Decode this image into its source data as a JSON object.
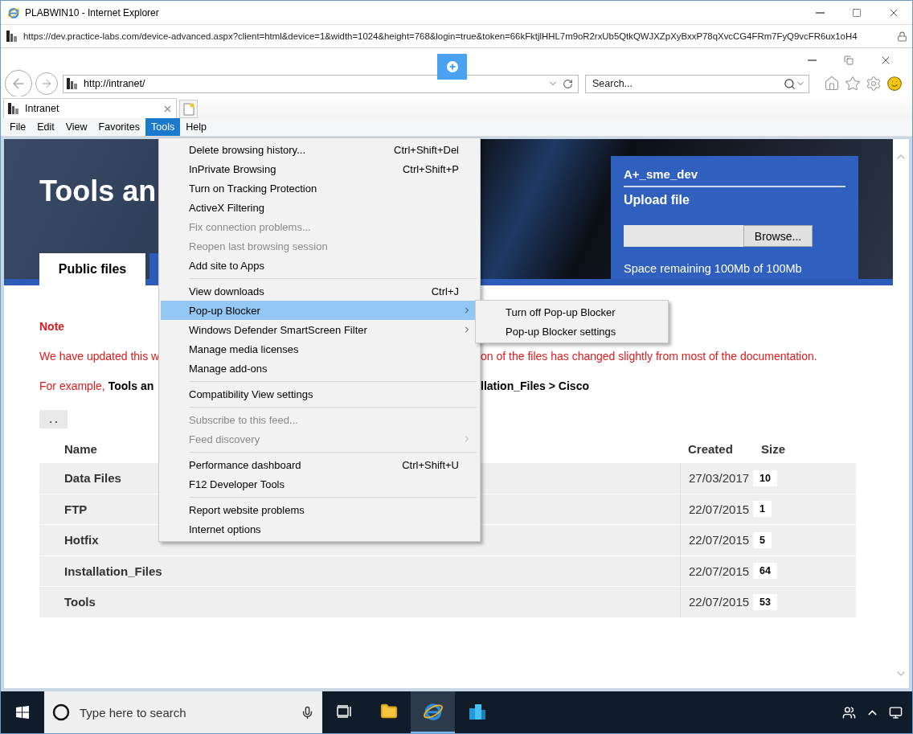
{
  "window": {
    "title": "PLABWIN10 - Internet Explorer"
  },
  "remote_url": "https://dev.practice-labs.com/device-advanced.aspx?client=html&device=1&width=1024&height=768&login=true&token=66kFktjlHHL7m9oR2rxUb5QtkQWJXZpXyBxxP78qXvcCG4FRm7FyQ9vcFR6ux1oH4",
  "browser": {
    "address": "http://intranet/",
    "search_placeholder": "Search...",
    "tab_title": "Intranet"
  },
  "menu_bar": [
    {
      "label": "File",
      "selected": false
    },
    {
      "label": "Edit",
      "selected": false
    },
    {
      "label": "View",
      "selected": false
    },
    {
      "label": "Favorites",
      "selected": false
    },
    {
      "label": "Tools",
      "selected": true
    },
    {
      "label": "Help",
      "selected": false
    }
  ],
  "tools_menu": {
    "groups": [
      [
        {
          "label": "Delete browsing history...",
          "shortcut": "Ctrl+Shift+Del",
          "disabled": false,
          "selected": false,
          "has_submenu": false
        },
        {
          "label": "InPrivate Browsing",
          "shortcut": "Ctrl+Shift+P",
          "disabled": false,
          "selected": false,
          "has_submenu": false
        },
        {
          "label": "Turn on Tracking Protection",
          "disabled": false,
          "selected": false,
          "has_submenu": false
        },
        {
          "label": "ActiveX Filtering",
          "disabled": false,
          "selected": false,
          "has_submenu": false
        },
        {
          "label": "Fix connection problems...",
          "disabled": true,
          "selected": false,
          "has_submenu": false
        },
        {
          "label": "Reopen last browsing session",
          "disabled": true,
          "selected": false,
          "has_submenu": false
        },
        {
          "label": "Add site to Apps",
          "disabled": false,
          "selected": false,
          "has_submenu": false
        }
      ],
      [
        {
          "label": "View downloads",
          "shortcut": "Ctrl+J",
          "disabled": false,
          "selected": false,
          "has_submenu": false
        },
        {
          "label": "Pop-up Blocker",
          "disabled": false,
          "selected": true,
          "has_submenu": true
        },
        {
          "label": "Windows Defender SmartScreen Filter",
          "disabled": false,
          "selected": false,
          "has_submenu": true
        },
        {
          "label": "Manage media licenses",
          "disabled": false,
          "selected": false,
          "has_submenu": false
        },
        {
          "label": "Manage add-ons",
          "disabled": false,
          "selected": false,
          "has_submenu": false
        }
      ],
      [
        {
          "label": "Compatibility View settings",
          "disabled": false,
          "selected": false,
          "has_submenu": false
        }
      ],
      [
        {
          "label": "Subscribe to this feed...",
          "disabled": true,
          "selected": false,
          "has_submenu": false
        },
        {
          "label": "Feed discovery",
          "disabled": true,
          "selected": false,
          "has_submenu": true
        }
      ],
      [
        {
          "label": "Performance dashboard",
          "shortcut": "Ctrl+Shift+U",
          "disabled": false,
          "selected": false,
          "has_submenu": false
        },
        {
          "label": "F12 Developer Tools",
          "disabled": false,
          "selected": false,
          "has_submenu": false
        }
      ],
      [
        {
          "label": "Report website problems",
          "disabled": false,
          "selected": false,
          "has_submenu": false
        },
        {
          "label": "Internet options",
          "disabled": false,
          "selected": false,
          "has_submenu": false
        }
      ]
    ]
  },
  "submenu": [
    "Turn off Pop-up Blocker",
    "Pop-up Blocker settings"
  ],
  "page": {
    "title": "Tools an",
    "tab": {
      "label": "Public files",
      "selected": true
    },
    "upload": {
      "user": "A+_sme_dev",
      "heading": "Upload file",
      "button": "Browse...",
      "space": "Space remaining 100Mb of 100Mb"
    },
    "note": {
      "heading": "Note",
      "line_left": "We have updated this w",
      "line_right": "on of the files has changed slightly from most of the documentation.",
      "example_prefix": "For example,",
      "example_path_left": "Tools an",
      "example_path_right": "llation_Files > Cisco"
    },
    "parent_button": ". .",
    "table": {
      "columns": [
        "Name",
        "Created",
        "Size"
      ],
      "rows": [
        {
          "name": "Data Files",
          "created": "27/03/2017",
          "size": "10"
        },
        {
          "name": "FTP",
          "created": "22/07/2015",
          "size": "1"
        },
        {
          "name": "Hotfix",
          "created": "22/07/2015",
          "size": "5"
        },
        {
          "name": "Installation_Files",
          "created": "22/07/2015",
          "size": "64"
        },
        {
          "name": "Tools",
          "created": "22/07/2015",
          "size": "53"
        }
      ]
    }
  },
  "taskbar": {
    "search_placeholder": "Type here to search"
  }
}
